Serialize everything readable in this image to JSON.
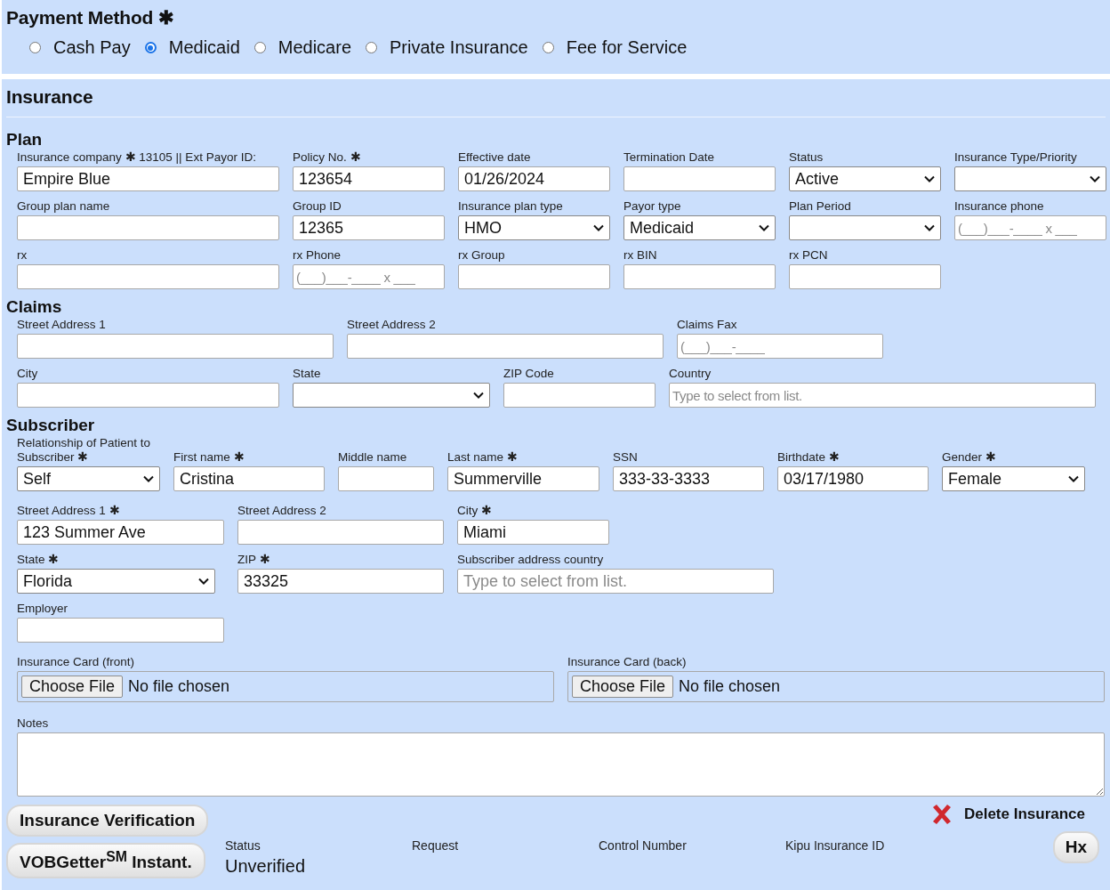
{
  "payment": {
    "title": "Payment Method ✱",
    "options": [
      {
        "label": "Cash Pay",
        "selected": false
      },
      {
        "label": "Medicaid",
        "selected": true
      },
      {
        "label": "Medicare",
        "selected": false
      },
      {
        "label": "Private Insurance",
        "selected": false
      },
      {
        "label": "Fee for Service",
        "selected": false
      }
    ]
  },
  "insurance": {
    "title": "Insurance",
    "sections": [
      {
        "title": "Plan",
        "rows": [
          {
            "fields": [
              {
                "kind": "text",
                "label": "Insurance company ✱ 13105 || Ext Payor ID:",
                "value": "Empire Blue"
              },
              {
                "kind": "text",
                "label": "Policy No. ✱",
                "value": "123654"
              },
              {
                "kind": "text",
                "label": "Effective date",
                "value": "01/26/2024"
              },
              {
                "kind": "text",
                "label": "Termination Date"
              },
              {
                "kind": "select",
                "label": "Status",
                "value": "Active"
              },
              {
                "kind": "select",
                "label": "Insurance Type/Priority"
              }
            ]
          },
          {
            "fields": [
              {
                "kind": "text",
                "label": "Group plan name"
              },
              {
                "kind": "text",
                "label": "Group ID",
                "value": "12365"
              },
              {
                "kind": "select",
                "label": "Insurance plan type",
                "value": "HMO"
              },
              {
                "kind": "select",
                "label": "Payor type",
                "value": "Medicaid"
              },
              {
                "kind": "select",
                "label": "Plan Period"
              },
              {
                "kind": "text",
                "label": "Insurance phone",
                "placeholder": "(___)___-____ x ___"
              }
            ]
          },
          {
            "fields": [
              {
                "kind": "text",
                "label": "rx"
              },
              {
                "kind": "text",
                "label": "rx Phone",
                "placeholder": "(___)___-____ x ___"
              },
              {
                "kind": "text",
                "label": "rx Group"
              },
              {
                "kind": "text",
                "label": "rx BIN"
              },
              {
                "kind": "text",
                "label": "rx PCN"
              }
            ]
          }
        ]
      },
      {
        "title": "Claims",
        "rows": [
          {
            "fields": [
              {
                "kind": "text",
                "label": "Street Address 1"
              },
              {
                "kind": "text",
                "label": "Street Address 2"
              },
              {
                "kind": "text",
                "label": "Claims Fax",
                "placeholder": "(___)___-____"
              }
            ]
          },
          {
            "fields": [
              {
                "kind": "text",
                "label": "City"
              },
              {
                "kind": "select",
                "label": "State"
              },
              {
                "kind": "text",
                "label": "ZIP Code"
              },
              {
                "kind": "text",
                "label": "Country",
                "placeholder": "Type to select from list."
              }
            ]
          }
        ]
      },
      {
        "title": "Subscriber",
        "rows": [
          {
            "fields": [
              {
                "kind": "select",
                "label": "Relationship of Patient to Subscriber ✱",
                "value": "Self"
              },
              {
                "kind": "text",
                "label": "First name ✱",
                "value": "Cristina"
              },
              {
                "kind": "text",
                "label": "Middle name"
              },
              {
                "kind": "text",
                "label": "Last name ✱",
                "value": "Summerville"
              },
              {
                "kind": "text",
                "label": "SSN",
                "value": "333-33-3333"
              },
              {
                "kind": "text",
                "label": "Birthdate ✱",
                "value": "03/17/1980"
              },
              {
                "kind": "select",
                "label": "Gender ✱",
                "value": "Female"
              }
            ]
          },
          {
            "fields": [
              {
                "kind": "text",
                "label": "Street Address 1 ✱",
                "value": "123 Summer Ave"
              },
              {
                "kind": "text",
                "label": "Street Address 2"
              },
              {
                "kind": "text",
                "label": "City ✱",
                "value": "Miami"
              }
            ]
          },
          {
            "fields": [
              {
                "kind": "select",
                "label": "State ✱",
                "value": "Florida"
              },
              {
                "kind": "text",
                "label": "ZIP ✱",
                "value": "33325"
              },
              {
                "kind": "text",
                "label": "Subscriber address country",
                "placeholder": "Type to select from list."
              }
            ]
          },
          {
            "fields": [
              {
                "kind": "text",
                "label": "Employer"
              }
            ]
          },
          {
            "fields": [
              {
                "kind": "file",
                "label": "Insurance Card (front)",
                "button": "Choose File",
                "value": "No file chosen"
              },
              {
                "kind": "file",
                "label": "Insurance Card (back)",
                "button": "Choose File",
                "value": "No file chosen"
              }
            ]
          },
          {
            "fields": [
              {
                "kind": "textarea",
                "label": "Notes"
              }
            ]
          }
        ]
      }
    ]
  },
  "actions": {
    "verify": "Insurance Verification",
    "vob": "VOBGetter$^{SM}$ Instant.",
    "delete": "Delete Insurance",
    "hx": "Hx",
    "columns": [
      {
        "label": "Status",
        "value": "Unverified"
      },
      {
        "label": "Request"
      },
      {
        "label": "Control Number"
      },
      {
        "label": "Kipu Insurance ID"
      }
    ]
  }
}
